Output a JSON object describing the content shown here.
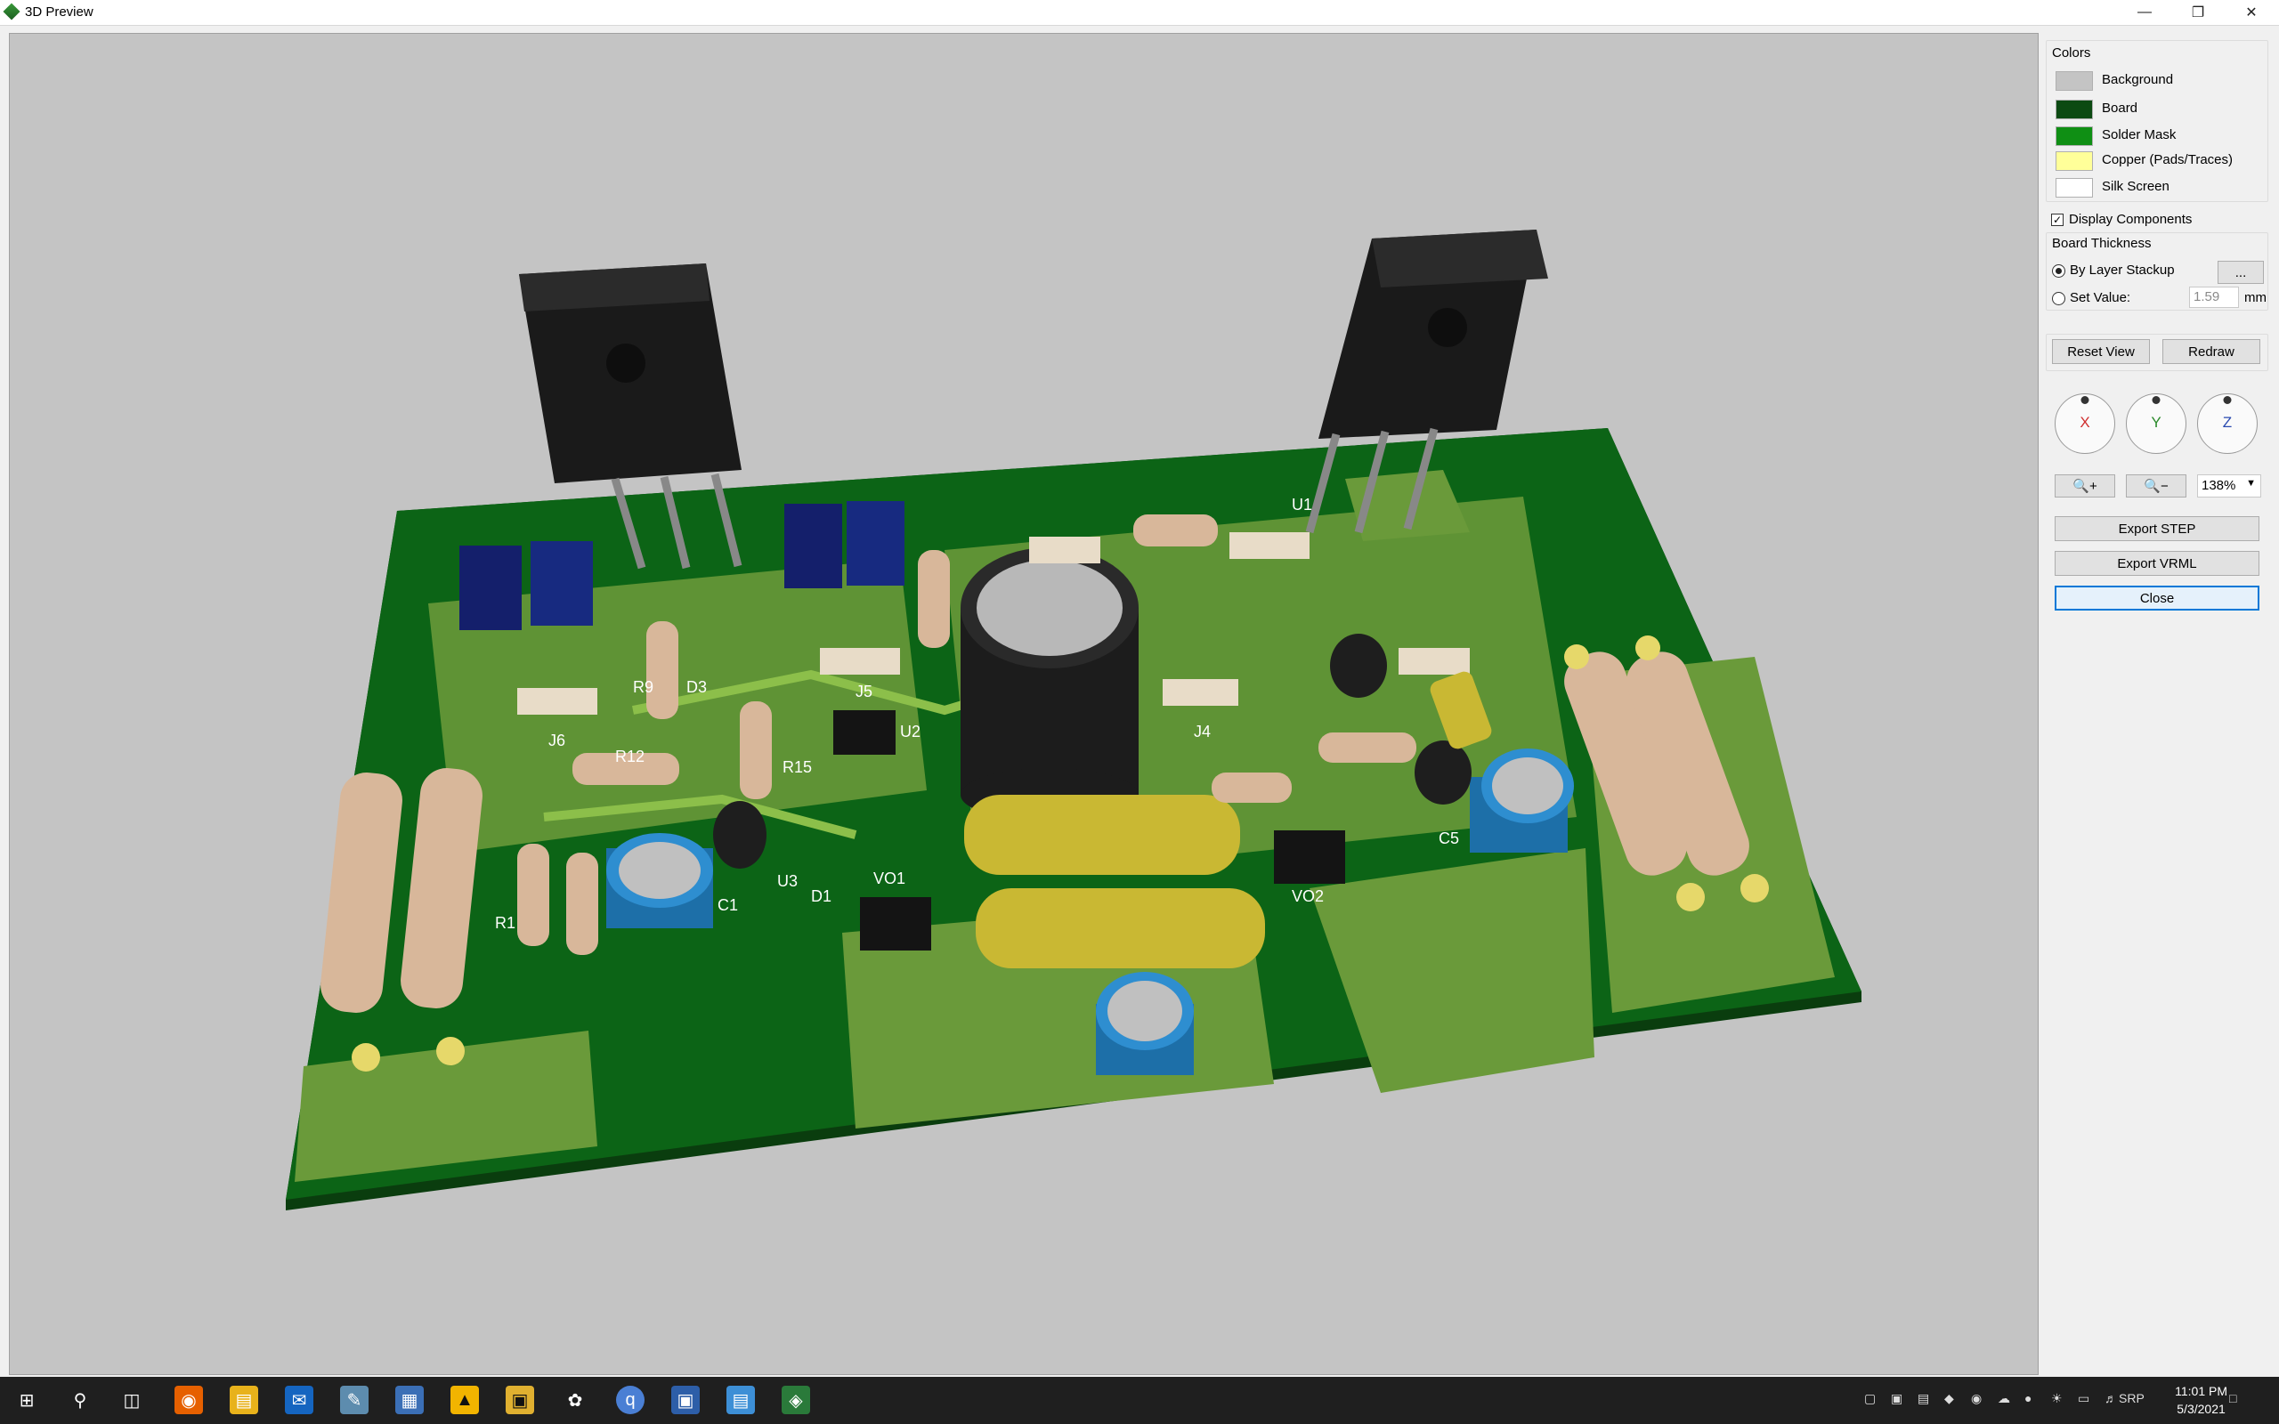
{
  "window": {
    "title": "3D Preview"
  },
  "colors_group": {
    "heading": "Colors",
    "items": [
      {
        "label": "Background",
        "color": "#c4c4c4"
      },
      {
        "label": "Board",
        "color": "#0c4a12"
      },
      {
        "label": "Solder Mask",
        "color": "#0f8f14"
      },
      {
        "label": "Copper (Pads/Traces)",
        "color": "#ffff99"
      },
      {
        "label": "Silk Screen",
        "color": "#ffffff"
      }
    ]
  },
  "display_components": {
    "label": "Display Components",
    "checked": true
  },
  "board_thickness": {
    "heading": "Board Thickness",
    "by_layer_label": "By Layer Stackup",
    "ellipsis_label": "...",
    "set_value_label": "Set Value:",
    "value": "1.59",
    "unit": "mm"
  },
  "buttons": {
    "reset_view": "Reset View",
    "redraw": "Redraw",
    "export_step": "Export STEP",
    "export_vrml": "Export VRML",
    "close": "Close"
  },
  "axes": {
    "x": "X",
    "y": "Y",
    "z": "Z"
  },
  "zoom": {
    "level": "138%"
  },
  "pcb_labels": [
    "R9",
    "D3",
    "J6",
    "R12",
    "R15",
    "U2",
    "J5",
    "U1",
    "J4",
    "R1",
    "C1",
    "C5",
    "VO1",
    "VO2",
    "D1",
    "U3"
  ],
  "taskbar": {
    "tray_language": "SRP",
    "time": "11:01 PM",
    "date": "5/3/2021"
  }
}
